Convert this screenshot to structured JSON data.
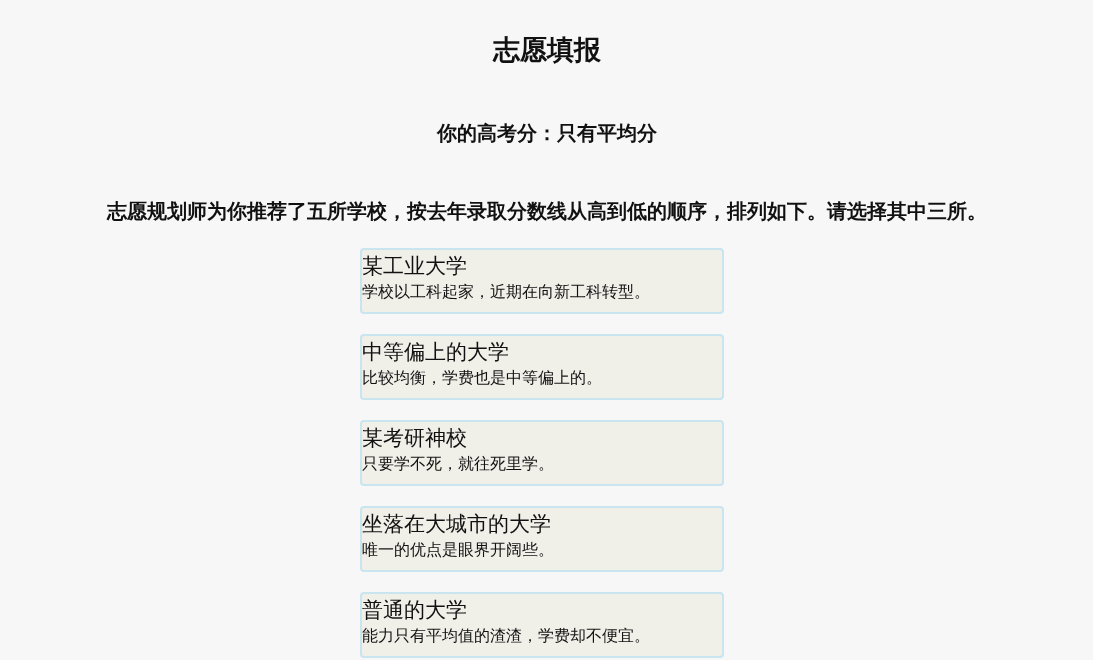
{
  "title": "志愿填报",
  "score_line": "你的高考分：只有平均分",
  "instruction": "志愿规划师为你推荐了五所学校，按去年录取分数线从高到低的顺序，排列如下。请选择其中三所。",
  "schools": [
    {
      "name": "某工业大学",
      "description": "学校以工科起家，近期在向新工科转型。"
    },
    {
      "name": "中等偏上的大学",
      "description": "比较均衡，学费也是中等偏上的。"
    },
    {
      "name": "某考研神校",
      "description": "只要学不死，就往死里学。"
    },
    {
      "name": "坐落在大城市的大学",
      "description": "唯一的优点是眼界开阔些。"
    },
    {
      "name": "普通的大学",
      "description": "能力只有平均值的渣渣，学费却不便宜。"
    }
  ]
}
